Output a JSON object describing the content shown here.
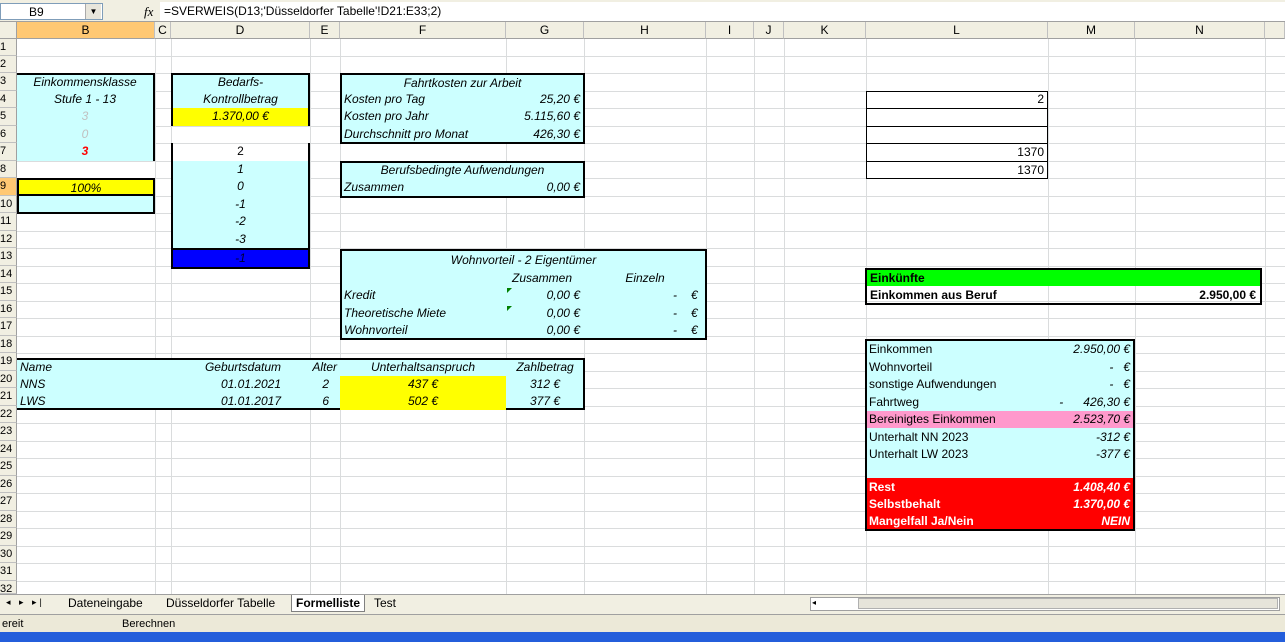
{
  "formula_bar": {
    "name_box": "B9",
    "fx": "fx",
    "formula": "=SVERWEIS(D13;'Düsseldorfer Tabelle'!D21:E33;2)"
  },
  "columns": [
    "B",
    "C",
    "D",
    "E",
    "F",
    "G",
    "H",
    "I",
    "J",
    "K",
    "L",
    "M",
    "N"
  ],
  "rows": [
    "1",
    "2",
    "3",
    "4",
    "5",
    "6",
    "7",
    "8",
    "9",
    "10",
    "11",
    "12",
    "13",
    "14",
    "15",
    "16",
    "17",
    "18",
    "19",
    "20",
    "21",
    "22",
    "23",
    "24",
    "25",
    "26",
    "27",
    "28",
    "29",
    "30",
    "31",
    "32"
  ],
  "einkommensklasse": {
    "title": "Einkommensklasse",
    "subtitle": "Stufe 1 - 13",
    "v1": "3",
    "v2": "0",
    "v3": "3",
    "percent": "100%"
  },
  "bedarf": {
    "title1": "Bedarfs-",
    "title2": "Kontrollbetrag",
    "amount": "1.370,00 €",
    "list": [
      "2",
      "1",
      "0",
      "-1",
      "-2",
      "-3"
    ],
    "selected": "-1"
  },
  "fahrtkosten": {
    "title": "Fahrtkosten zur Arbeit",
    "rows": [
      {
        "label": "Kosten pro Tag",
        "value": "25,20 €"
      },
      {
        "label": "Kosten pro Jahr",
        "value": "5.115,60 €"
      },
      {
        "label": "Durchschnitt pro Monat",
        "value": "426,30 €"
      }
    ]
  },
  "berufsbedingt": {
    "title": "Berufsbedingte Aufwendungen",
    "label": "Zusammen",
    "value": "0,00 €"
  },
  "wohnvorteil": {
    "title": "Wohnvorteil - 2 Eigentümer",
    "col1": "Zusammen",
    "col2": "Einzeln",
    "rows": [
      {
        "label": "Kredit",
        "zus": "0,00 €",
        "ein": "-",
        "cur": "€"
      },
      {
        "label": "Theoretische Miete",
        "zus": "0,00 €",
        "ein": "-",
        "cur": "€"
      },
      {
        "label": "Wohnvorteil",
        "zus": "0,00 €",
        "ein": "-",
        "cur": "€"
      }
    ]
  },
  "kinder": {
    "headers": {
      "name": "Name",
      "geb": "Geburtsdatum",
      "alter": "Alter",
      "anspruch": "Unterhaltsanspruch",
      "zahl": "Zahlbetrag"
    },
    "rows": [
      {
        "name": "NNS",
        "geb": "01.01.2021",
        "alter": "2",
        "anspruch": "437 €",
        "zahl": "312 €"
      },
      {
        "name": "LWS",
        "geb": "01.01.2017",
        "alter": "6",
        "anspruch": "502 €",
        "zahl": "377 €"
      }
    ]
  },
  "l_column": {
    "l4": "2",
    "l7": "1370",
    "l8": "1370"
  },
  "einkuenfte": {
    "title": "Einkünfte",
    "label": "Einkommen aus Beruf",
    "value": "2.950,00 €"
  },
  "summary": {
    "rows": [
      {
        "label": "Einkommen",
        "value": "2.950,00 €"
      },
      {
        "label": "Wohnvorteil",
        "value": "-   €"
      },
      {
        "label": "sonstige Aufwendungen",
        "value": "-   €"
      },
      {
        "label": "Fahrtweg",
        "value": "-      426,30 €"
      },
      {
        "label": "Bereinigtes Einkommen",
        "value": "2.523,70 €"
      },
      {
        "label": "Unterhalt NN 2023",
        "value": "-312 €"
      },
      {
        "label": "Unterhalt LW 2023",
        "value": "-377 €"
      }
    ],
    "rest_label": "Rest",
    "rest_value": "1.408,40 €",
    "selbst_label": "Selbstbehalt",
    "selbst_value": "1.370,00 €",
    "mangel_label": "Mangelfall Ja/Nein",
    "mangel_value": "NEIN"
  },
  "sheet_tabs": [
    "Dateneingabe",
    "Düsseldorfer Tabelle",
    "Formelliste",
    "Test"
  ],
  "active_tab": "Formelliste",
  "status": {
    "left": "ereit",
    "mid": "Berechnen"
  },
  "colors": {
    "cyan": "#ccffff",
    "yellow": "#ffff00",
    "blue": "#0000ff",
    "green": "#00ff00",
    "red": "#ff0000",
    "pink": "#ff99cc"
  }
}
